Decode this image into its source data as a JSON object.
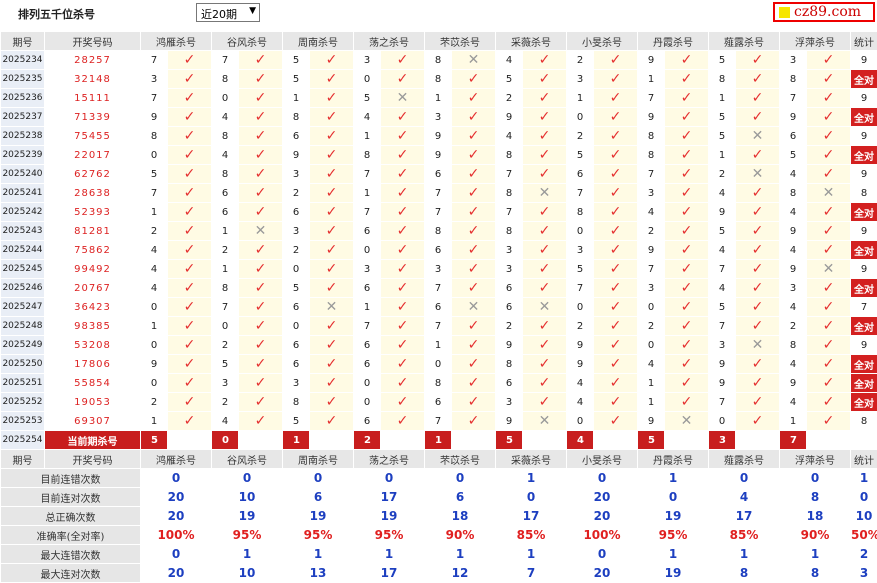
{
  "page": {
    "title": "排列五千位杀号",
    "period_select": "近20期",
    "logo": "cz89.com"
  },
  "columns": [
    "期号",
    "开奖号码",
    "鸿雁杀号",
    "谷风杀号",
    "周南杀号",
    "荡之杀号",
    "芣苡杀号",
    "采薇杀号",
    "小旻杀号",
    "丹霞杀号",
    "薤露杀号",
    "浮萍杀号",
    "统计"
  ],
  "rows": [
    {
      "p": "2025234",
      "n": "28257",
      "k": [
        "7",
        "7",
        "5",
        "3",
        "8",
        "4",
        "2",
        "9",
        "5",
        "3"
      ],
      "r": [
        1,
        1,
        1,
        1,
        0,
        1,
        1,
        1,
        1,
        1
      ],
      "s": "9"
    },
    {
      "p": "2025235",
      "n": "32148",
      "k": [
        "3",
        "8",
        "5",
        "0",
        "8",
        "5",
        "3",
        "1",
        "8",
        "8"
      ],
      "r": [
        1,
        1,
        1,
        1,
        1,
        1,
        1,
        1,
        1,
        1
      ],
      "s": "全对"
    },
    {
      "p": "2025236",
      "n": "15111",
      "k": [
        "7",
        "0",
        "1",
        "5",
        "1",
        "2",
        "1",
        "7",
        "1",
        "7"
      ],
      "r": [
        1,
        1,
        1,
        0,
        1,
        1,
        1,
        1,
        1,
        1
      ],
      "s": "9"
    },
    {
      "p": "2025237",
      "n": "71339",
      "k": [
        "9",
        "4",
        "8",
        "4",
        "3",
        "9",
        "0",
        "9",
        "5",
        "9"
      ],
      "r": [
        1,
        1,
        1,
        1,
        1,
        1,
        1,
        1,
        1,
        1
      ],
      "s": "全对"
    },
    {
      "p": "2025238",
      "n": "75455",
      "k": [
        "8",
        "8",
        "6",
        "1",
        "9",
        "4",
        "2",
        "8",
        "5",
        "6"
      ],
      "r": [
        1,
        1,
        1,
        1,
        1,
        1,
        1,
        1,
        0,
        1
      ],
      "s": "9"
    },
    {
      "p": "2025239",
      "n": "22017",
      "k": [
        "0",
        "4",
        "9",
        "8",
        "9",
        "8",
        "5",
        "8",
        "1",
        "5"
      ],
      "r": [
        1,
        1,
        1,
        1,
        1,
        1,
        1,
        1,
        1,
        1
      ],
      "s": "全对"
    },
    {
      "p": "2025240",
      "n": "62762",
      "k": [
        "5",
        "8",
        "3",
        "7",
        "6",
        "7",
        "6",
        "7",
        "2",
        "4"
      ],
      "r": [
        1,
        1,
        1,
        1,
        1,
        1,
        1,
        1,
        0,
        1
      ],
      "s": "9"
    },
    {
      "p": "2025241",
      "n": "28638",
      "k": [
        "7",
        "6",
        "2",
        "1",
        "7",
        "8",
        "7",
        "3",
        "4",
        "8"
      ],
      "r": [
        1,
        1,
        1,
        1,
        1,
        0,
        1,
        1,
        1,
        0
      ],
      "s": "8"
    },
    {
      "p": "2025242",
      "n": "52393",
      "k": [
        "1",
        "6",
        "6",
        "7",
        "7",
        "7",
        "8",
        "4",
        "9",
        "4"
      ],
      "r": [
        1,
        1,
        1,
        1,
        1,
        1,
        1,
        1,
        1,
        1
      ],
      "s": "全对"
    },
    {
      "p": "2025243",
      "n": "81281",
      "k": [
        "2",
        "1",
        "3",
        "6",
        "8",
        "8",
        "0",
        "2",
        "5",
        "9"
      ],
      "r": [
        1,
        0,
        1,
        1,
        1,
        1,
        1,
        1,
        1,
        1
      ],
      "s": "9"
    },
    {
      "p": "2025244",
      "n": "75862",
      "k": [
        "4",
        "2",
        "2",
        "0",
        "6",
        "3",
        "3",
        "9",
        "4",
        "4"
      ],
      "r": [
        1,
        1,
        1,
        1,
        1,
        1,
        1,
        1,
        1,
        1
      ],
      "s": "全对"
    },
    {
      "p": "2025245",
      "n": "99492",
      "k": [
        "4",
        "1",
        "0",
        "3",
        "3",
        "3",
        "5",
        "7",
        "7",
        "9"
      ],
      "r": [
        1,
        1,
        1,
        1,
        1,
        1,
        1,
        1,
        1,
        0
      ],
      "s": "9"
    },
    {
      "p": "2025246",
      "n": "20767",
      "k": [
        "4",
        "8",
        "5",
        "6",
        "7",
        "6",
        "7",
        "3",
        "4",
        "3"
      ],
      "r": [
        1,
        1,
        1,
        1,
        1,
        1,
        1,
        1,
        1,
        1
      ],
      "s": "全对"
    },
    {
      "p": "2025247",
      "n": "36423",
      "k": [
        "0",
        "7",
        "6",
        "1",
        "6",
        "6",
        "0",
        "0",
        "5",
        "4"
      ],
      "r": [
        1,
        1,
        0,
        1,
        0,
        0,
        1,
        1,
        1,
        1
      ],
      "s": "7"
    },
    {
      "p": "2025248",
      "n": "98385",
      "k": [
        "1",
        "0",
        "0",
        "7",
        "7",
        "2",
        "2",
        "2",
        "7",
        "2"
      ],
      "r": [
        1,
        1,
        1,
        1,
        1,
        1,
        1,
        1,
        1,
        1
      ],
      "s": "全对"
    },
    {
      "p": "2025249",
      "n": "53208",
      "k": [
        "0",
        "2",
        "6",
        "6",
        "1",
        "9",
        "9",
        "0",
        "3",
        "8"
      ],
      "r": [
        1,
        1,
        1,
        1,
        1,
        1,
        1,
        1,
        0,
        1
      ],
      "s": "9"
    },
    {
      "p": "2025250",
      "n": "17806",
      "k": [
        "9",
        "5",
        "6",
        "6",
        "0",
        "8",
        "9",
        "4",
        "9",
        "4"
      ],
      "r": [
        1,
        1,
        1,
        1,
        1,
        1,
        1,
        1,
        1,
        1
      ],
      "s": "全对"
    },
    {
      "p": "2025251",
      "n": "55854",
      "k": [
        "0",
        "3",
        "3",
        "0",
        "8",
        "6",
        "4",
        "1",
        "9",
        "9"
      ],
      "r": [
        1,
        1,
        1,
        1,
        1,
        1,
        1,
        1,
        1,
        1
      ],
      "s": "全对"
    },
    {
      "p": "2025252",
      "n": "19053",
      "k": [
        "2",
        "2",
        "8",
        "0",
        "6",
        "3",
        "4",
        "1",
        "7",
        "4"
      ],
      "r": [
        1,
        1,
        1,
        1,
        1,
        1,
        1,
        1,
        1,
        1
      ],
      "s": "全对"
    },
    {
      "p": "2025253",
      "n": "69307",
      "k": [
        "1",
        "4",
        "5",
        "6",
        "7",
        "9",
        "0",
        "9",
        "0",
        "1"
      ],
      "r": [
        1,
        1,
        1,
        1,
        1,
        0,
        1,
        0,
        1,
        1
      ],
      "s": "8"
    }
  ],
  "current": {
    "p": "2025254",
    "label": "当前期杀号",
    "k": [
      "5",
      "0",
      "1",
      "2",
      "1",
      "5",
      "4",
      "5",
      "3",
      "7"
    ]
  },
  "summary": [
    {
      "label": "目前连错次数",
      "v": [
        "0",
        "0",
        "0",
        "0",
        "0",
        "1",
        "0",
        "1",
        "0",
        "0",
        "1"
      ]
    },
    {
      "label": "目前连对次数",
      "v": [
        "20",
        "10",
        "6",
        "17",
        "6",
        "0",
        "20",
        "0",
        "4",
        "8",
        "0"
      ]
    },
    {
      "label": "总正确次数",
      "v": [
        "20",
        "19",
        "19",
        "19",
        "18",
        "17",
        "20",
        "19",
        "17",
        "18",
        "10"
      ]
    },
    {
      "label": "准确率(全对率)",
      "v": [
        "100%",
        "95%",
        "95%",
        "95%",
        "90%",
        "85%",
        "100%",
        "95%",
        "85%",
        "90%",
        "50%"
      ]
    },
    {
      "label": "最大连错次数",
      "v": [
        "0",
        "1",
        "1",
        "1",
        "1",
        "1",
        "0",
        "1",
        "1",
        "1",
        "2"
      ]
    },
    {
      "label": "最大连对次数",
      "v": [
        "20",
        "10",
        "13",
        "17",
        "12",
        "7",
        "20",
        "19",
        "8",
        "8",
        "3"
      ]
    }
  ],
  "marks": {
    "ok": "✓",
    "no": "✕"
  },
  "colors": {
    "check": "#e53030",
    "cross": "#9a9a9a",
    "accent": "#c81e1e",
    "mark_bg": "#fffbe4"
  }
}
